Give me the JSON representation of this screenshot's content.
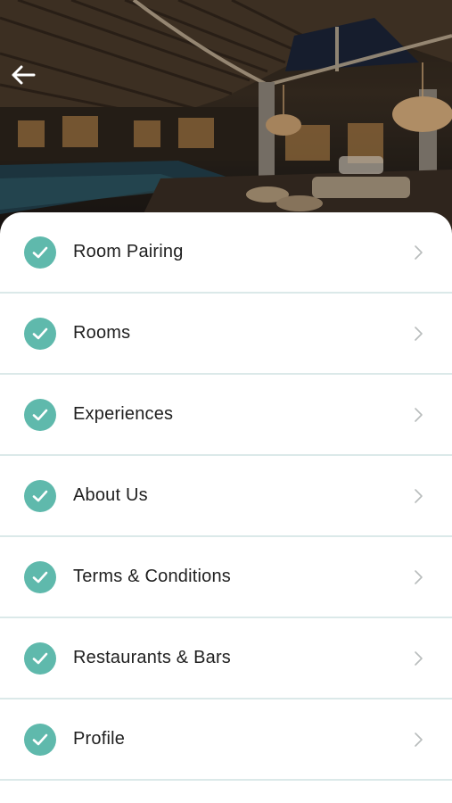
{
  "header": {
    "back_icon": "arrow-left-icon",
    "hero_image": "resort-lobby-photo"
  },
  "menu": {
    "accent_color": "#5fb9ac",
    "divider_color": "#dbe9e9",
    "items": [
      {
        "label": "Room Pairing",
        "icon": "check-circle-icon"
      },
      {
        "label": "Rooms",
        "icon": "check-circle-icon"
      },
      {
        "label": "Experiences",
        "icon": "check-circle-icon"
      },
      {
        "label": "About Us",
        "icon": "check-circle-icon"
      },
      {
        "label": "Terms & Conditions",
        "icon": "check-circle-icon"
      },
      {
        "label": "Restaurants & Bars",
        "icon": "check-circle-icon"
      },
      {
        "label": "Profile",
        "icon": "check-circle-icon"
      }
    ]
  }
}
